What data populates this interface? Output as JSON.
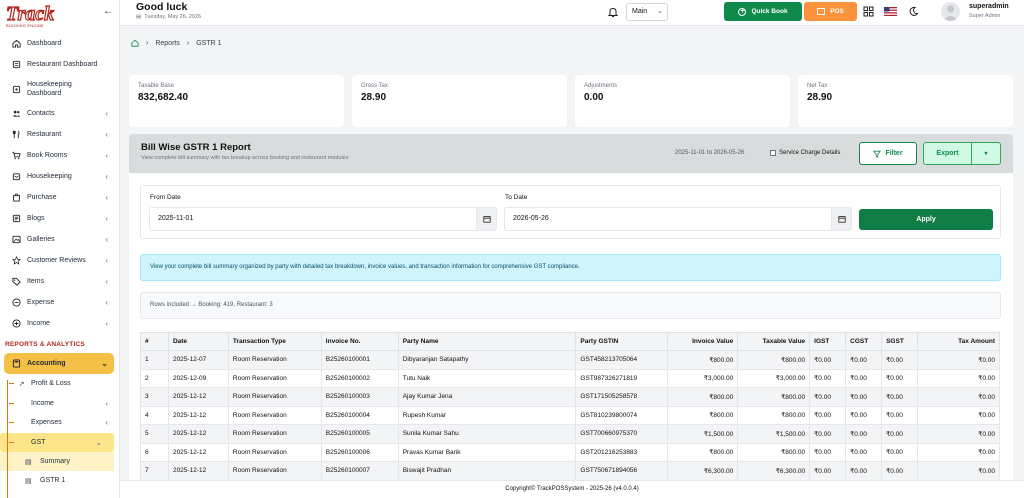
{
  "brand": {
    "logo_text": "Track",
    "logo_sub": "BOOKING ENGINE"
  },
  "header": {
    "greeting": "Good luck",
    "date": "Tuesday, May 26, 2026",
    "branch": "Main",
    "quick_book": "Quick Book",
    "pos": "POS",
    "user_name": "superadmin",
    "user_role": "Super Admin"
  },
  "sidebar": {
    "items": [
      {
        "label": "Dashboard",
        "icon": "home-icon"
      },
      {
        "label": "Restaurant Dashboard",
        "icon": "store-icon"
      },
      {
        "label": "Housekeeping Dashboard",
        "icon": "broom-icon"
      },
      {
        "label": "Contacts",
        "icon": "users-icon"
      },
      {
        "label": "Restaurant",
        "icon": "utensils-icon"
      },
      {
        "label": "Book Rooms",
        "icon": "cart-icon"
      },
      {
        "label": "Housekeeping",
        "icon": "box-icon"
      },
      {
        "label": "Purchase",
        "icon": "bag-icon"
      },
      {
        "label": "Blogs",
        "icon": "blog-icon"
      },
      {
        "label": "Galleries",
        "icon": "gallery-icon"
      },
      {
        "label": "Customer Reviews",
        "icon": "star-icon"
      },
      {
        "label": "Items",
        "icon": "tag-icon"
      },
      {
        "label": "Expense",
        "icon": "minus-circle-icon"
      },
      {
        "label": "Income",
        "icon": "plus-circle-icon"
      }
    ],
    "section_title": "REPORTS & ANALYTICS",
    "accounting": "Accounting",
    "sub_items": [
      "Profit & Loss",
      "Income",
      "Expenses",
      "GST"
    ],
    "gst_items": [
      "Summary",
      "GSTR 1"
    ]
  },
  "breadcrumb": {
    "reports": "Reports",
    "current": "GSTR 1"
  },
  "stats": [
    {
      "label": "Taxable Base",
      "value": "832,682.40"
    },
    {
      "label": "Gross Tax",
      "value": "28.90"
    },
    {
      "label": "Adjustments",
      "value": "0.00"
    },
    {
      "label": "Net Tax",
      "value": "28.90"
    }
  ],
  "report": {
    "title": "Bill Wise GSTR 1 Report",
    "subtitle": "View complete bill summary with tax breakup across booking and restaurant modules",
    "range": "2025-11-01 to 2026-05-26",
    "service_charge": "Service Charge Details",
    "filter": "Filter",
    "export": "Export",
    "from_label": "From Date",
    "from_value": "2025-11-01",
    "to_label": "To Date",
    "to_value": "2026-05-26",
    "apply": "Apply",
    "info": "View your complete bill summary organized by party with detailed tax breakdown, invoice values, and transaction information for comprehensive GST compliance.",
    "rows_included": "Rows included → Booking: 419, Restaurant: 3"
  },
  "table": {
    "headers": [
      "#",
      "Date",
      "Transaction Type",
      "Invoice No.",
      "Party Name",
      "Party GSTIN",
      "Invoice Value",
      "Taxable Value",
      "IGST",
      "CGST",
      "SGST",
      "Tax Amount"
    ],
    "rows": [
      [
        "1",
        "2025-12-07",
        "Room Reservation",
        "B25260100001",
        "Dibyaranjan Satapathy",
        "GST458213705064",
        "₹800.00",
        "₹800.00",
        "₹0.00",
        "₹0.00",
        "₹0.00",
        "₹0.00"
      ],
      [
        "2",
        "2025-12-09",
        "Room Reservation",
        "B25260100002",
        "Tutu Naik",
        "GST987326271819",
        "₹3,000.00",
        "₹3,000.00",
        "₹0.00",
        "₹0.00",
        "₹0.00",
        "₹0.00"
      ],
      [
        "3",
        "2025-12-12",
        "Room Reservation",
        "B25260100003",
        "Ajay Kumar Jena",
        "GST171505258578",
        "₹800.00",
        "₹800.00",
        "₹0.00",
        "₹0.00",
        "₹0.00",
        "₹0.00"
      ],
      [
        "4",
        "2025-12-12",
        "Room Reservation",
        "B25260100004",
        "Rupesh Kumar",
        "GST810239800074",
        "₹800.00",
        "₹800.00",
        "₹0.00",
        "₹0.00",
        "₹0.00",
        "₹0.00"
      ],
      [
        "5",
        "2025-12-12",
        "Room Reservation",
        "B25260100005",
        "Sunila Kumar Sahu",
        "GST700660975370",
        "₹1,500.00",
        "₹1,500.00",
        "₹0.00",
        "₹0.00",
        "₹0.00",
        "₹0.00"
      ],
      [
        "6",
        "2025-12-12",
        "Room Reservation",
        "B25260100006",
        "Pravas Kumar Barik",
        "GST201216253883",
        "₹800.00",
        "₹800.00",
        "₹0.00",
        "₹0.00",
        "₹0.00",
        "₹0.00"
      ],
      [
        "7",
        "2025-12-12",
        "Room Reservation",
        "B25260100007",
        "Biswajit Pradhan",
        "GST750671894056",
        "₹6,300.00",
        "₹6,300.00",
        "₹0.00",
        "₹0.00",
        "₹0.00",
        "₹0.00"
      ]
    ]
  },
  "footer": "Copyright© TrackPOSSystem - 2025-26 (v4.0.0.4)",
  "colors": {
    "primary": "#0f8a4b",
    "accent": "#f5c046",
    "pos": "#fb923c",
    "brand_red": "#b3261e"
  }
}
